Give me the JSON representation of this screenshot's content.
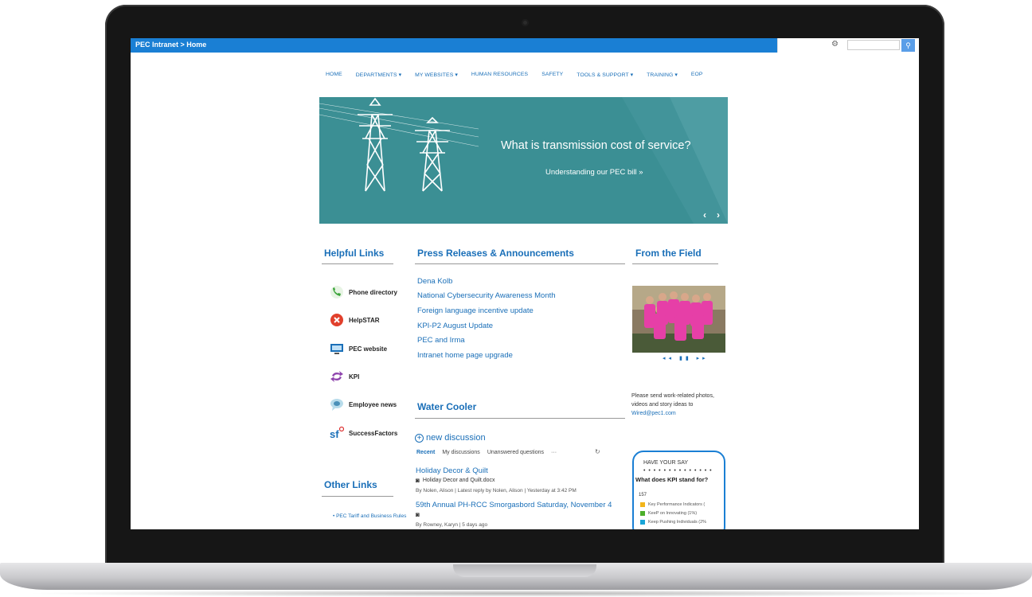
{
  "topbar": {
    "breadcrumb": "PEC Intranet > Home"
  },
  "nav": [
    "HOME",
    "DEPARTMENTS ▾",
    "MY WEBSITES ▾",
    "HUMAN RESOURCES",
    "SAFETY",
    "TOOLS & SUPPORT ▾",
    "TRAINING ▾",
    "EOP"
  ],
  "hero": {
    "headline": "What is transmission cost of service?",
    "subtext": "Understanding our PEC bill »",
    "prev": "‹",
    "next": "›"
  },
  "helpful_links": {
    "title": "Helpful Links",
    "items": [
      {
        "label": "Phone directory",
        "icon": "phone-icon"
      },
      {
        "label": "HelpSTAR",
        "icon": "helpstar-icon"
      },
      {
        "label": "PEC website",
        "icon": "monitor-icon"
      },
      {
        "label": "KPI",
        "icon": "kpi-arrows-icon"
      },
      {
        "label": "Employee news",
        "icon": "speech-bubble-icon"
      },
      {
        "label": "SuccessFactors",
        "icon": "successfactors-logo-icon"
      }
    ]
  },
  "press": {
    "title": "Press Releases & Announcements",
    "items": [
      "Dena Kolb",
      "National Cybersecurity Awareness Month",
      "Foreign language incentive update",
      "KPI-P2 August Update",
      "PEC and Irma",
      "Intranet home page upgrade"
    ]
  },
  "water_cooler": {
    "title": "Water Cooler",
    "new_discussion": "new discussion",
    "tabs": [
      "Recent",
      "My discussions",
      "Unanswered questions",
      "···"
    ],
    "discussions": [
      {
        "title": "Holiday Decor & Quilt",
        "attachment": "Holiday Decor and Quilt.docx",
        "meta": "By Nolen, Alison  |  Latest reply by Nolen, Alison  |  Yesterday at 3:42 PM"
      },
      {
        "title": "59th Annual PH-RCC Smorgasbord Saturday, November 4",
        "attachment": "",
        "meta": "By Rowney, Karyn  |  5 days ago"
      }
    ]
  },
  "field": {
    "title": "From the Field",
    "photo_nav": "◂◂ ▮▮ ▸▸",
    "send_text": "Please send work-related photos, videos and story ideas to",
    "email": "Wired@pec1.com"
  },
  "poll": {
    "heading": "HAVE YOUR SAY",
    "dots": "• • • • • • • • • • • • • •",
    "question": "What does KPI stand for?",
    "count": "157",
    "options": [
      {
        "label": "Key Performance Indicators (",
        "color": "#f2b51a"
      },
      {
        "label": "KeeP on Innovating (1%)",
        "color": "#4caf2a"
      },
      {
        "label": "Keep Pushing Individuals (2%",
        "color": "#1aa5d8"
      }
    ]
  },
  "other_links": {
    "title": "Other Links",
    "items": [
      "PEC Tariff and Business Rules"
    ]
  }
}
